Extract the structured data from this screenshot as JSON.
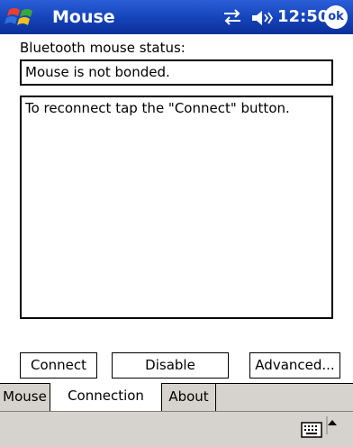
{
  "titlebar": {
    "app_title": "Mouse",
    "clock": "12:50",
    "ok_label": "ok"
  },
  "icons": {
    "start": "windows-flag-icon",
    "connectivity": "connectivity-arrows-icon",
    "volume": "speaker-icon",
    "keyboard": "keyboard-icon",
    "input_menu": "up-arrow-icon"
  },
  "content": {
    "status_label": "Bluetooth mouse status:",
    "status_value": "Mouse is not bonded.",
    "message": "To reconnect tap the \"Connect\" button."
  },
  "buttons": {
    "connect": "Connect",
    "disable": "Disable",
    "advanced": "Advanced..."
  },
  "tabs": [
    {
      "label": "Mouse"
    },
    {
      "label": "Connection",
      "selected": true
    },
    {
      "label": "About"
    }
  ],
  "colors": {
    "titlebar": "#1442b8",
    "tab_strip": "#d6d3ce"
  }
}
